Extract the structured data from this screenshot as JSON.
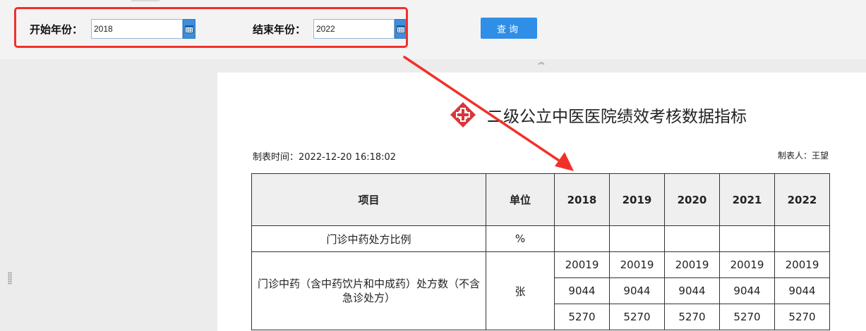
{
  "search": {
    "start_label": "开始年份：",
    "start_value": "2018",
    "end_label": "结束年份：",
    "end_value": "2022",
    "query_label": "查询"
  },
  "colors": {
    "annotation": "#f2302a",
    "query_button": "#2f8ee6",
    "calendar_button": "#3d8edb"
  },
  "report": {
    "title": "二级公立中医医院绩效考核数据指标",
    "made_time": "制表时间：2022-12-20 16:18:02",
    "made_by": "制表人：王望",
    "headers": {
      "item": "项目",
      "unit": "单位",
      "years": [
        "2018",
        "2019",
        "2020",
        "2021",
        "2022"
      ]
    },
    "rows": [
      {
        "item": "门诊中药处方比例",
        "unit": "%",
        "values": [
          [
            "",
            "",
            "",
            "",
            ""
          ]
        ]
      },
      {
        "item": "门诊中药（含中药饮片和中成药）处方数（不含急诊处方）",
        "unit": "张",
        "values": [
          [
            "20019",
            "20019",
            "20019",
            "20019",
            "20019"
          ],
          [
            "9044",
            "9044",
            "9044",
            "9044",
            "9044"
          ],
          [
            "5270",
            "5270",
            "5270",
            "5270",
            "5270"
          ]
        ]
      }
    ]
  },
  "icons": {
    "calendar": "calendar-icon",
    "logo": "red-cross-logo-icon",
    "collapse": "chevron-up-icon",
    "annotation_arrow": "red-arrow"
  }
}
